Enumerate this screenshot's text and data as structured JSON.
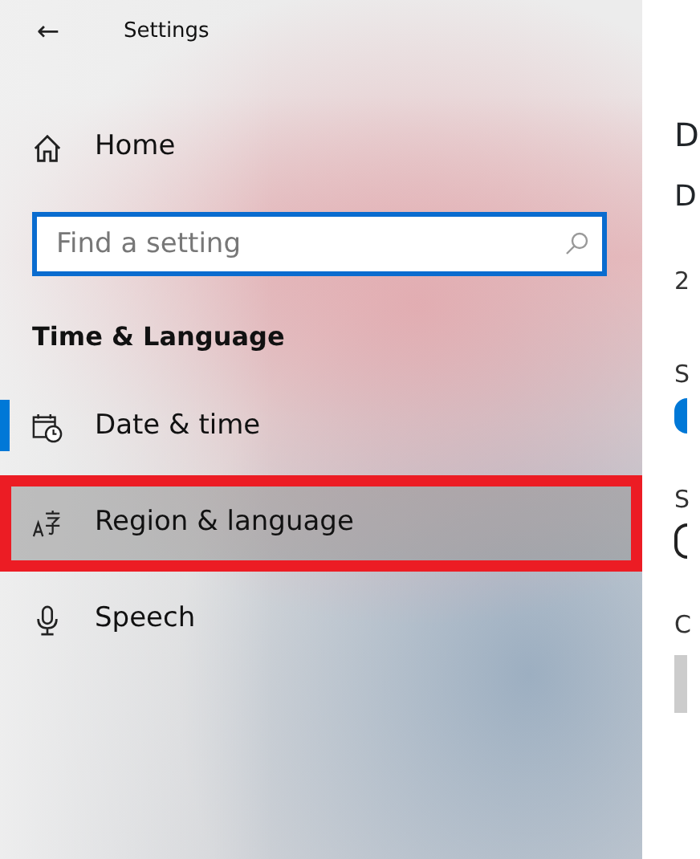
{
  "window": {
    "title": "Settings",
    "back": "←"
  },
  "sidebar": {
    "home": {
      "label": "Home"
    },
    "search": {
      "placeholder": "Find a setting"
    },
    "section": "Time & Language",
    "items": [
      {
        "label": "Date & time",
        "selected": true,
        "highlighted": false
      },
      {
        "label": "Region & language",
        "selected": false,
        "highlighted": true
      },
      {
        "label": "Speech",
        "selected": false,
        "highlighted": false
      }
    ]
  },
  "content": [
    {
      "kind": "heading",
      "text": "D"
    },
    {
      "kind": "subheading",
      "text": "D"
    },
    {
      "kind": "text",
      "text": "2"
    },
    {
      "kind": "label",
      "text": "S"
    },
    {
      "kind": "toggle",
      "on": true
    },
    {
      "kind": "label",
      "text": "S"
    },
    {
      "kind": "toggle",
      "on": false
    },
    {
      "kind": "label",
      "text": "C"
    },
    {
      "kind": "dropdown"
    }
  ]
}
